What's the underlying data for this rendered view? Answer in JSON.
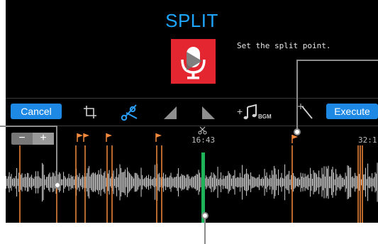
{
  "title": "SPLIT",
  "hint": "Set the split point.",
  "toolbar": {
    "cancel_label": "Cancel",
    "execute_label": "Execute",
    "bgm_label": "BGM",
    "plus": "+"
  },
  "timeline": {
    "zoom_minus": "−",
    "zoom_plus": "+",
    "current_time": "16:43",
    "end_time": "32:1"
  },
  "colors": {
    "accent": "#1e88e5",
    "title": "#1ea6ff",
    "marker": "#f58a3c",
    "split_cursor": "#1fb45a",
    "mic_bg": "#e3262f",
    "waveform": "#bfbfbf"
  },
  "icons": [
    "mic-icon",
    "play-icon",
    "crop-icon",
    "scissors-icon",
    "fade-in-icon",
    "fade-out-icon",
    "bgm-icon",
    "magic-wand-icon",
    "flag-icon"
  ]
}
